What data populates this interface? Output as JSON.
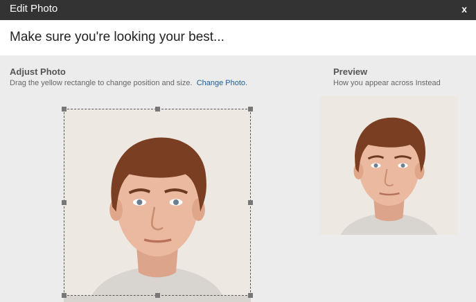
{
  "dialog": {
    "title": "Edit Photo",
    "close_label": "x",
    "headline": "Make sure you're looking your best..."
  },
  "adjust": {
    "title": "Adjust Photo",
    "instructions": "Drag the yellow rectangle to change position and size.",
    "change_link": "Change Photo."
  },
  "preview": {
    "title": "Preview",
    "subtitle": "How you appear across Instead"
  },
  "colors": {
    "titlebar": "#333333",
    "background": "#ececec",
    "link": "#1a5b97",
    "photo_background": "#ede8e2",
    "hair": "#7a3f22",
    "skin": "#eab9a0"
  }
}
